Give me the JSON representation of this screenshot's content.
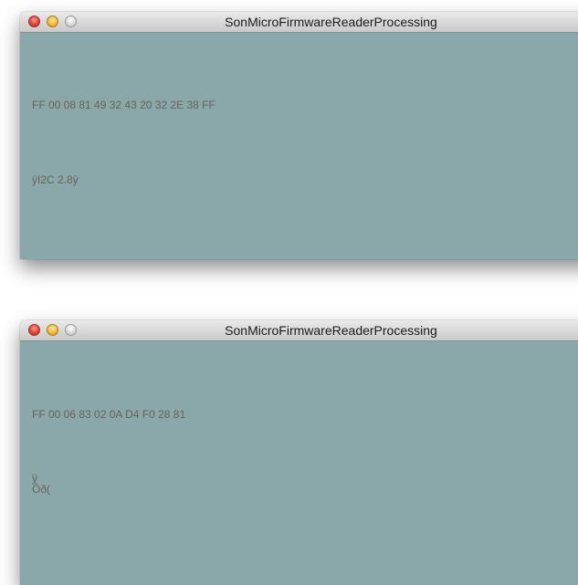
{
  "windows": [
    {
      "title": "SonMicroFirmwareReaderProcessing",
      "hex_line": "FF 00 08 81 49 32 43 20 32 2E 38 FF",
      "char_line": "ÿI2C 2.8ÿ"
    },
    {
      "title": "SonMicroFirmwareReaderProcessing",
      "hex_line": "FF 00 06 83 02 0A D4 F0 28 81",
      "char_line": "ÿ\nÔð("
    }
  ],
  "colors": {
    "canvas_background": "#8aa8aa",
    "text": "#6b6152",
    "close_button": "#e0423a",
    "minimize_button": "#f4b83c",
    "zoom_button": "#d7d7d7"
  },
  "icons": {
    "close": "close-icon",
    "minimize": "minimize-icon",
    "zoom": "zoom-icon"
  }
}
